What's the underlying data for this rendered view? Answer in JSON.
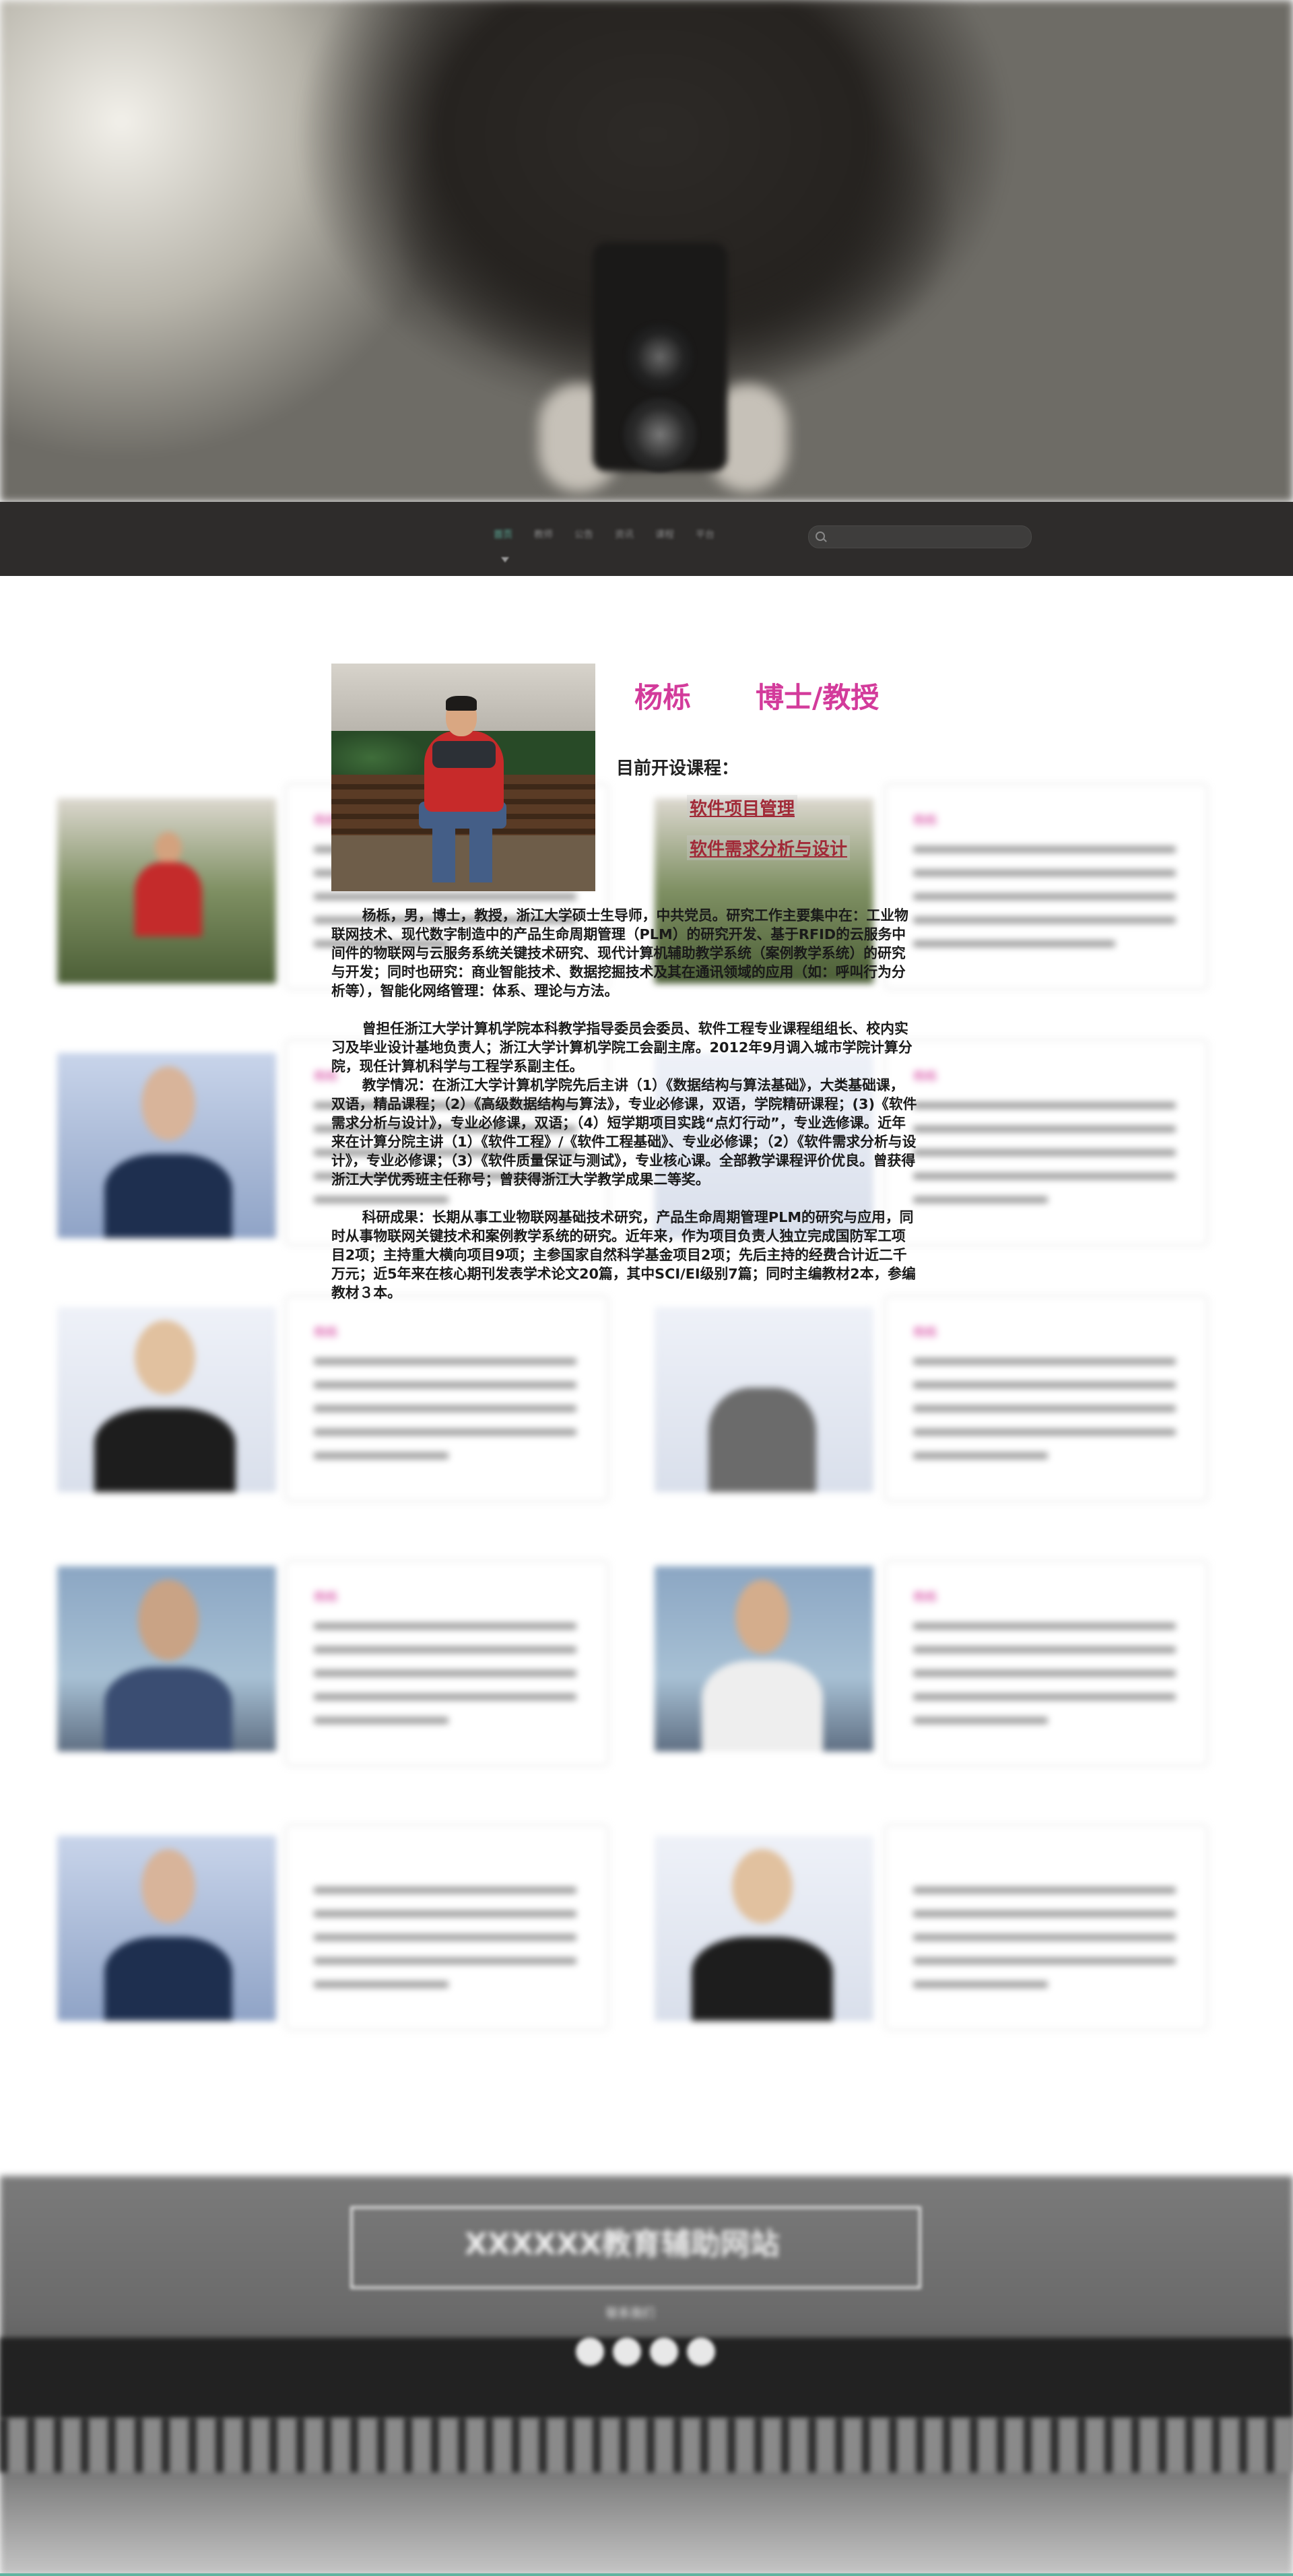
{
  "nav": {
    "items": [
      "首页",
      "教师",
      "公告",
      "资讯",
      "课程",
      "平台"
    ],
    "search_placeholder": ""
  },
  "grid_cards": [
    {
      "title": "杨栎",
      "subtitle": "博士/教授"
    },
    {
      "title": "杨栎",
      "subtitle": "博士/教授"
    },
    {
      "title": "杨栎",
      "subtitle": "博士/教授"
    },
    {
      "title": "杨栎",
      "subtitle": "博士/教授"
    },
    {
      "title": "杨栎",
      "subtitle": "博士/教授"
    },
    {
      "title": "杨栎",
      "subtitle": "博士/教授"
    },
    {
      "title": "杨栎",
      "subtitle": "博士/教授"
    },
    {
      "title": "杨栎",
      "subtitle": "博士/教授"
    }
  ],
  "profile": {
    "name": "杨栎",
    "title": "博士/教授",
    "courses_heading": "目前开设课程：",
    "courses": [
      "软件项目管理",
      "软件需求分析与设计"
    ],
    "bio_1": "杨栎，男，博士，教授，浙江大学硕士生导师，中共党员。研究工作主要集中在：工业物联网技术、现代数字制造中的产品生命周期管理（PLM）的研究开发、基于RFID的云服务中间件的物联网与云服务系统关键技术研究、现代计算机辅助教学系统（案例教学系统）的研究与开发；同时也研究：商业智能技术、数据挖掘技术及其在通讯领域的应用（如：呼叫行为分析等），智能化网络管理：体系、理论与方法。",
    "bio_2": "曾担任浙江大学计算机学院本科教学指导委员会委员、软件工程专业课程组组长、校内实习及毕业设计基地负责人；浙江大学计算机学院工会副主席。2012年9月调入城市学院计算分院，现任计算机科学与工程学系副主任。",
    "bio_3": "教学情况：在浙江大学计算机学院先后主讲（1）《数据结构与算法基础》，大类基础课，双语，精品课程；（2）《高级数据结构与算法》，专业必修课，双语，学院精研课程；(3)《软件需求分析与设计》，专业必修课，双语；（4）短学期项目实践“点灯行动”，专业选修课。近年来在计算分院主讲（1）《软件工程》/《软件工程基础》、专业必修课；（2）《软件需求分析与设计》，专业必修课；（3）《软件质量保证与测试》，专业核心课。全部教学课程评价优良。曾获得浙江大学优秀班主任称号；曾获得浙江大学教学成果二等奖。",
    "bio_4": "科研成果：长期从事工业物联网基础技术研究，产品生命周期管理PLM的研究与应用，同时从事物联网关键技术和案例教学系统的研究。近年来，作为项目负责人独立完成国防军工项目2项；主持重大横向项目9项；主参国家自然科学基金项目2项；先后主持的经费合计近二千万元；近5年来在核心期刊发表学术论文20篇，其中SCI/EI级别7篇；同时主编教材2本，参编教材３本。"
  },
  "footer": {
    "logo_text": "XXXXXX教育辅助网站",
    "sub_text": "联系我们"
  },
  "colors": {
    "accent_pink": "#d33b9b",
    "course_link": "#a12a38",
    "nav_active": "#5fb4a0",
    "nav_bg": "#2e2c2b"
  }
}
